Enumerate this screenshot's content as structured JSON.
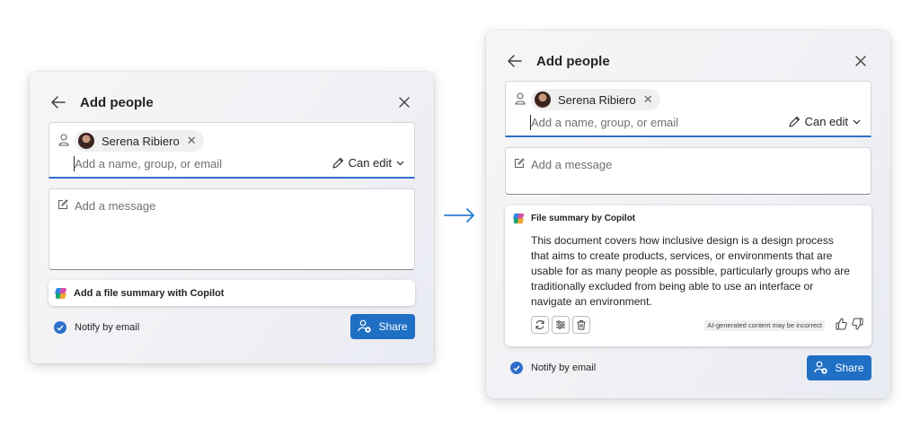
{
  "colors": {
    "accent": "#2f6fc9",
    "share_button": "#1f6fc4",
    "arrow": "#2b7cd3"
  },
  "before": {
    "header": {
      "title": "Add people"
    },
    "recipient": {
      "name": "Serena Ribiero"
    },
    "add_field": {
      "placeholder": "Add a name, group, or email"
    },
    "permission": {
      "label": "Can edit"
    },
    "message": {
      "placeholder": "Add a message"
    },
    "copilot_button": {
      "label": "Add a file summary with Copilot"
    },
    "notify": {
      "label": "Notify by email",
      "checked": true
    },
    "share": {
      "label": "Share"
    }
  },
  "after": {
    "header": {
      "title": "Add people"
    },
    "recipient": {
      "name": "Serena Ribiero"
    },
    "add_field": {
      "placeholder": "Add a name, group, or email"
    },
    "permission": {
      "label": "Can edit"
    },
    "message": {
      "placeholder": "Add a message"
    },
    "summary": {
      "title": "File summary by Copilot",
      "text": "This document covers how inclusive design is a design process that aims to create products, services, or environments that are usable for as many people as possible, particularly groups who are traditionally excluded from being able to use an interface or navigate an environment.",
      "ai_note": "AI-generated content may be incorrect"
    },
    "notify": {
      "label": "Notify by email",
      "checked": true
    },
    "share": {
      "label": "Share"
    }
  },
  "icons": [
    "back-arrow-icon",
    "close-icon",
    "person-icon",
    "pencil-icon",
    "chevron-down-icon",
    "compose-icon",
    "copilot-icon",
    "retry-icon",
    "adjust-icon",
    "trash-icon",
    "thumbs-up-icon",
    "thumbs-down-icon",
    "checkmark-icon",
    "share-person-icon",
    "transition-arrow-icon"
  ]
}
